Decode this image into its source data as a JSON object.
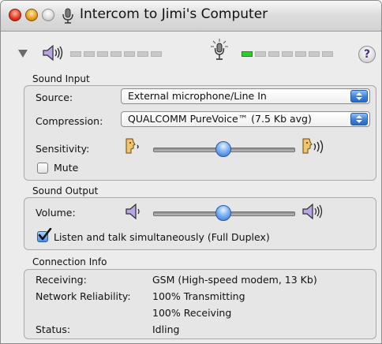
{
  "window": {
    "title": "Intercom to Jimi's Computer"
  },
  "toolbar": {
    "help_label": "?",
    "output_meter": {
      "segments": 7,
      "lit": 0
    },
    "input_meter": {
      "segments": 7,
      "lit": 1
    }
  },
  "sound_input": {
    "section_label": "Sound Input",
    "source_label": "Source:",
    "source_value": "External microphone/Line In",
    "compression_label": "Compression:",
    "compression_value": "QUALCOMM PureVoice™ (7.5 Kb avg)",
    "sensitivity_label": "Sensitivity:",
    "sensitivity_level": 0.5,
    "mute_label": "Mute",
    "mute_checked": false
  },
  "sound_output": {
    "section_label": "Sound Output",
    "volume_label": "Volume:",
    "volume_level": 0.5,
    "full_duplex_label": "Listen and talk simultaneously (Full Duplex)",
    "full_duplex_checked": true
  },
  "connection_info": {
    "section_label": "Connection Info",
    "receiving_label": "Receiving:",
    "receiving_value": "GSM (High-speed modem, 13 Kb)",
    "reliability_label": "Network Reliability:",
    "reliability_value_1": "100% Transmitting",
    "reliability_value_2": "100% Receiving",
    "status_label": "Status:",
    "status_value": "Idling"
  },
  "colors": {
    "accent": "#3d7fd6",
    "meter_on": "#2fce2f"
  },
  "icons": [
    "close-icon",
    "minimize-icon",
    "zoom-icon",
    "intercom-app-icon",
    "disclosure-triangle-icon",
    "speaker-icon",
    "microphone-icon",
    "help-icon",
    "speaking-head-icon",
    "speaker-loud-icon",
    "checkmark-icon"
  ]
}
